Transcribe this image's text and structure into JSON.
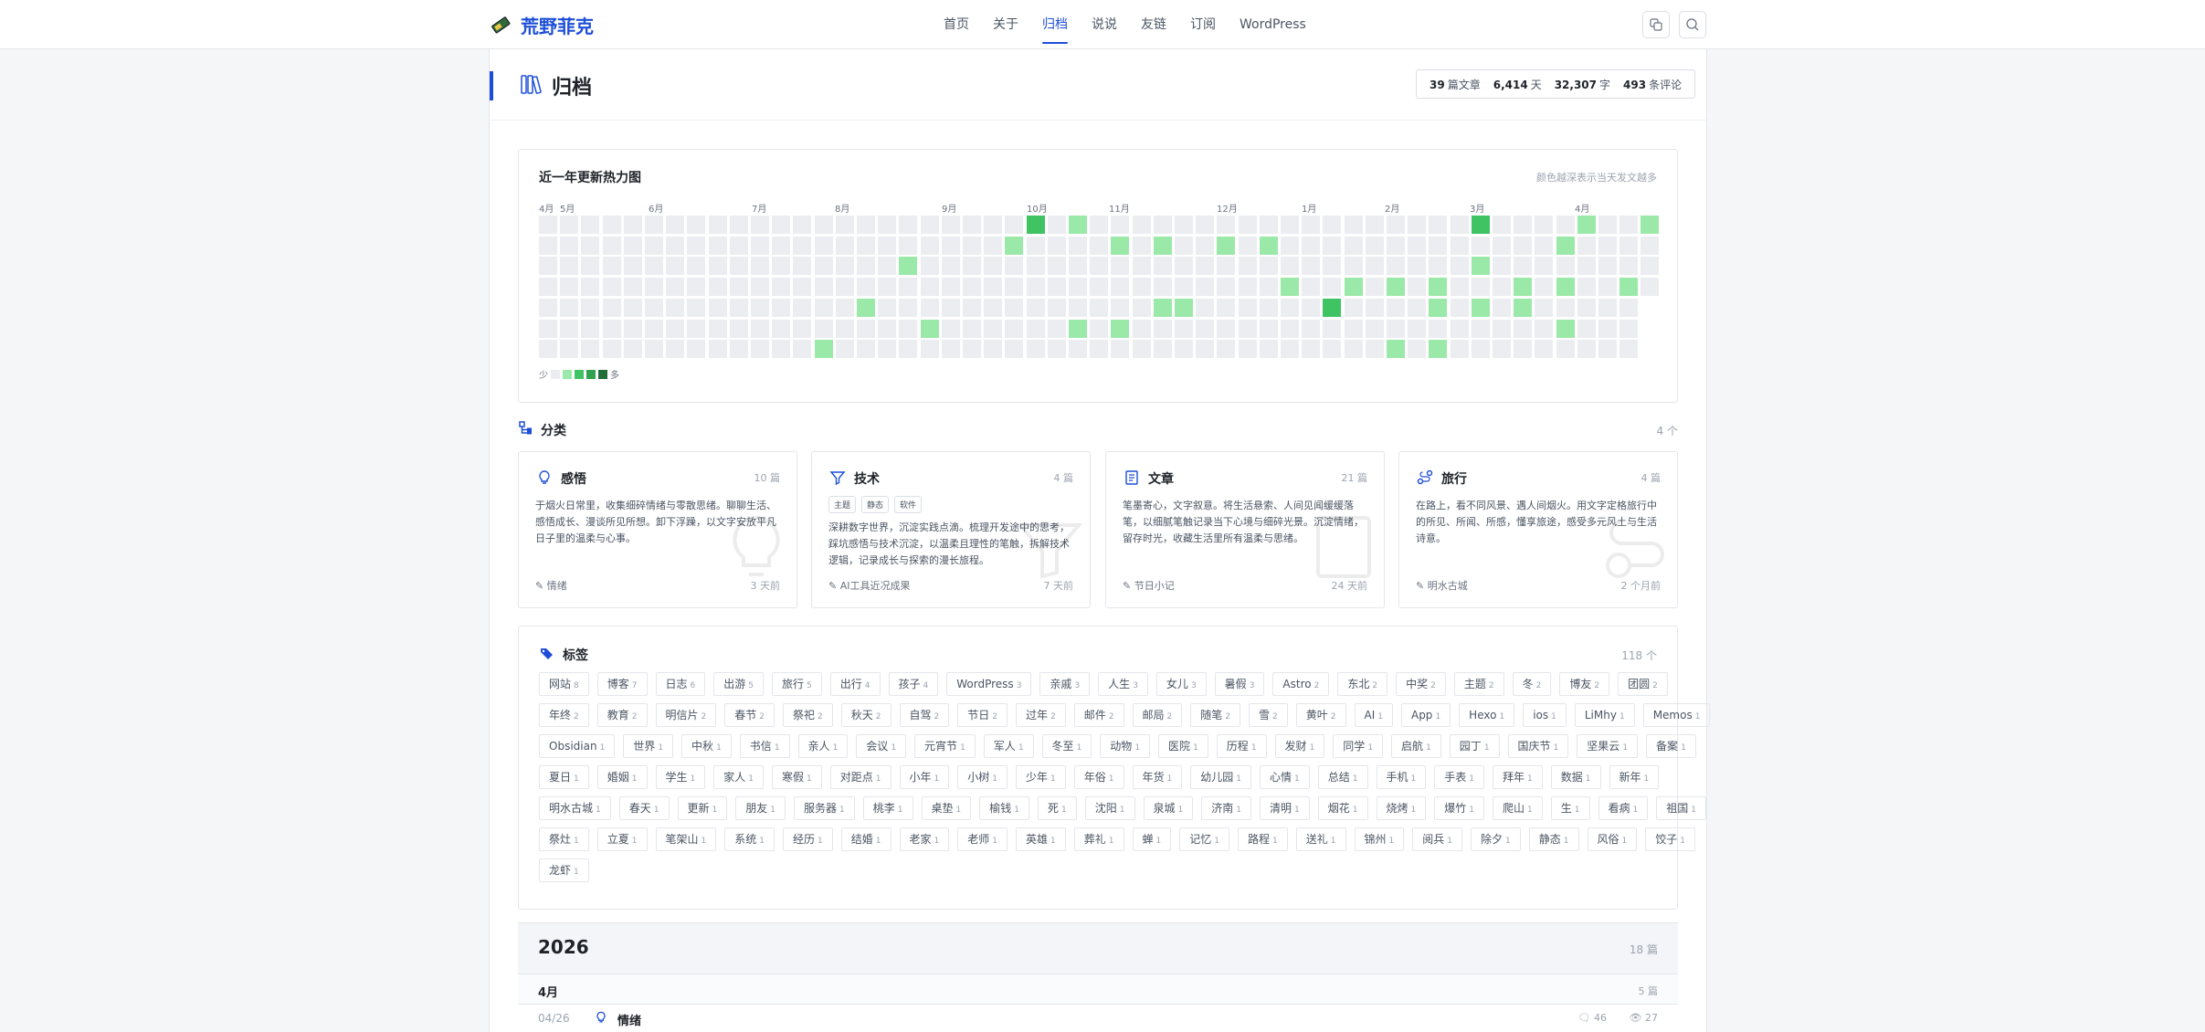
{
  "site": {
    "name": "荒野菲克"
  },
  "nav": [
    {
      "label": "首页",
      "active": false
    },
    {
      "label": "关于",
      "active": false
    },
    {
      "label": "归档",
      "active": true
    },
    {
      "label": "说说",
      "active": false
    },
    {
      "label": "友链",
      "active": false
    },
    {
      "label": "订阅",
      "active": false
    },
    {
      "label": "WordPress",
      "active": false
    }
  ],
  "page": {
    "title": "归档"
  },
  "stats": {
    "posts": "39",
    "posts_unit": "篇文章",
    "days": "6,414",
    "days_unit": "天",
    "words": "32,307",
    "words_unit": "字",
    "comments": "493",
    "comments_unit": "条评论"
  },
  "heatmap": {
    "title": "近一年更新热力图",
    "hint": "颜色越深表示当天发文越多",
    "months": [
      "4月",
      "5月",
      "6月",
      "7月",
      "8月",
      "9月",
      "10月",
      "11月",
      "12月",
      "1月",
      "2月",
      "3月",
      "4月"
    ],
    "legend_less": "少",
    "legend_more": "多",
    "colors": [
      "#ebedf0",
      "#9be9a8",
      "#40c463",
      "#30a14e",
      "#216e39"
    ],
    "active_days": [
      {
        "week": 23,
        "day": 0,
        "level": 2
      },
      {
        "week": 25,
        "day": 0,
        "level": 1
      },
      {
        "week": 44,
        "day": 0,
        "level": 2
      },
      {
        "week": 49,
        "day": 0,
        "level": 1
      },
      {
        "week": 52,
        "day": 0,
        "level": 1
      },
      {
        "week": 22,
        "day": 1,
        "level": 1
      },
      {
        "week": 27,
        "day": 1,
        "level": 1
      },
      {
        "week": 29,
        "day": 1,
        "level": 1
      },
      {
        "week": 32,
        "day": 1,
        "level": 1
      },
      {
        "week": 34,
        "day": 1,
        "level": 1
      },
      {
        "week": 48,
        "day": 1,
        "level": 1
      },
      {
        "week": 17,
        "day": 2,
        "level": 1
      },
      {
        "week": 44,
        "day": 2,
        "level": 1
      },
      {
        "week": 35,
        "day": 3,
        "level": 1
      },
      {
        "week": 38,
        "day": 3,
        "level": 1
      },
      {
        "week": 40,
        "day": 3,
        "level": 1
      },
      {
        "week": 42,
        "day": 3,
        "level": 1
      },
      {
        "week": 46,
        "day": 3,
        "level": 1
      },
      {
        "week": 48,
        "day": 3,
        "level": 1
      },
      {
        "week": 51,
        "day": 3,
        "level": 1
      },
      {
        "week": 15,
        "day": 4,
        "level": 1
      },
      {
        "week": 29,
        "day": 4,
        "level": 1
      },
      {
        "week": 30,
        "day": 4,
        "level": 1
      },
      {
        "week": 37,
        "day": 4,
        "level": 2
      },
      {
        "week": 42,
        "day": 4,
        "level": 1
      },
      {
        "week": 44,
        "day": 4,
        "level": 1
      },
      {
        "week": 46,
        "day": 4,
        "level": 1
      },
      {
        "week": 18,
        "day": 5,
        "level": 1
      },
      {
        "week": 25,
        "day": 5,
        "level": 1
      },
      {
        "week": 27,
        "day": 5,
        "level": 1
      },
      {
        "week": 48,
        "day": 5,
        "level": 1
      },
      {
        "week": 13,
        "day": 6,
        "level": 1
      },
      {
        "week": 40,
        "day": 6,
        "level": 1
      },
      {
        "week": 42,
        "day": 6,
        "level": 1
      }
    ]
  },
  "categories_section": {
    "title": "分类",
    "count": "4 个"
  },
  "categories": [
    {
      "name": "感悟",
      "count": "10 篇",
      "desc": "于烟火日常里，收集细碎情绪与零散思绪。聊聊生活、感悟成长、漫谈所见所想。卸下浮躁，以文字安放平凡日子里的温柔与心事。",
      "chips": [],
      "latest": "情绪",
      "time": "3 天前",
      "icon": "lightbulb-icon"
    },
    {
      "name": "技术",
      "count": "4 篇",
      "desc": "深耕数字世界，沉淀实践点滴。梳理开发途中的思考，踩坑感悟与技术沉淀，以温柔且理性的笔触，拆解技术逻辑，记录成长与探索的漫长旅程。",
      "chips": [
        "主题",
        "静态",
        "软件"
      ],
      "latest": "AI工具近况成果",
      "time": "7 天前",
      "icon": "filter-icon"
    },
    {
      "name": "文章",
      "count": "21 篇",
      "desc": "笔墨寄心，文字叙意。将生活悬索、人间见闻缓缓落笔，以细腻笔触记录当下心境与细碎光景。沉淀情绪，留存时光，收藏生活里所有温柔与思绪。",
      "chips": [],
      "latest": "节日小记",
      "time": "24 天前",
      "icon": "document-icon"
    },
    {
      "name": "旅行",
      "count": "4 篇",
      "desc": "在路上，看不同风景、遇人间烟火。用文字定格旅行中的所见、所闻、所感，懂享旅途，感受多元风土与生活诗意。",
      "chips": [],
      "latest": "明水古城",
      "time": "2 个月前",
      "icon": "route-icon"
    }
  ],
  "tags_section": {
    "title": "标签",
    "count": "118 个"
  },
  "tag_rows": [
    [
      [
        "网站",
        "8"
      ],
      [
        "博客",
        "7"
      ],
      [
        "日志",
        "6"
      ],
      [
        "出游",
        "5"
      ],
      [
        "旅行",
        "5"
      ],
      [
        "出行",
        "4"
      ],
      [
        "孩子",
        "4"
      ],
      [
        "WordPress",
        "3"
      ],
      [
        "亲戚",
        "3"
      ],
      [
        "人生",
        "3"
      ],
      [
        "女儿",
        "3"
      ],
      [
        "暑假",
        "3"
      ],
      [
        "Astro",
        "2"
      ],
      [
        "东北",
        "2"
      ],
      [
        "中奖",
        "2"
      ],
      [
        "主题",
        "2"
      ],
      [
        "冬",
        "2"
      ],
      [
        "博友",
        "2"
      ],
      [
        "团圆",
        "2"
      ]
    ],
    [
      [
        "年终",
        "2"
      ],
      [
        "教育",
        "2"
      ],
      [
        "明信片",
        "2"
      ],
      [
        "春节",
        "2"
      ],
      [
        "祭祀",
        "2"
      ],
      [
        "秋天",
        "2"
      ],
      [
        "自驾",
        "2"
      ],
      [
        "节日",
        "2"
      ],
      [
        "过年",
        "2"
      ],
      [
        "邮件",
        "2"
      ],
      [
        "邮局",
        "2"
      ],
      [
        "随笔",
        "2"
      ],
      [
        "雪",
        "2"
      ],
      [
        "黄叶",
        "2"
      ],
      [
        "AI",
        "1"
      ],
      [
        "App",
        "1"
      ],
      [
        "Hexo",
        "1"
      ],
      [
        "ios",
        "1"
      ],
      [
        "LiMhy",
        "1"
      ],
      [
        "Memos",
        "1"
      ]
    ],
    [
      [
        "Obsidian",
        "1"
      ],
      [
        "世界",
        "1"
      ],
      [
        "中秋",
        "1"
      ],
      [
        "书信",
        "1"
      ],
      [
        "亲人",
        "1"
      ],
      [
        "会议",
        "1"
      ],
      [
        "元宵节",
        "1"
      ],
      [
        "军人",
        "1"
      ],
      [
        "冬至",
        "1"
      ],
      [
        "动物",
        "1"
      ],
      [
        "医院",
        "1"
      ],
      [
        "历程",
        "1"
      ],
      [
        "发财",
        "1"
      ],
      [
        "同学",
        "1"
      ],
      [
        "启航",
        "1"
      ],
      [
        "园丁",
        "1"
      ],
      [
        "国庆节",
        "1"
      ],
      [
        "坚果云",
        "1"
      ],
      [
        "备案",
        "1"
      ]
    ],
    [
      [
        "夏日",
        "1"
      ],
      [
        "婚姻",
        "1"
      ],
      [
        "学生",
        "1"
      ],
      [
        "家人",
        "1"
      ],
      [
        "寒假",
        "1"
      ],
      [
        "对距点",
        "1"
      ],
      [
        "小年",
        "1"
      ],
      [
        "小树",
        "1"
      ],
      [
        "少年",
        "1"
      ],
      [
        "年俗",
        "1"
      ],
      [
        "年货",
        "1"
      ],
      [
        "幼儿园",
        "1"
      ],
      [
        "心情",
        "1"
      ],
      [
        "总结",
        "1"
      ],
      [
        "手机",
        "1"
      ],
      [
        "手表",
        "1"
      ],
      [
        "拜年",
        "1"
      ],
      [
        "数据",
        "1"
      ],
      [
        "新年",
        "1"
      ]
    ],
    [
      [
        "明水古城",
        "1"
      ],
      [
        "春天",
        "1"
      ],
      [
        "更新",
        "1"
      ],
      [
        "朋友",
        "1"
      ],
      [
        "服务器",
        "1"
      ],
      [
        "桃李",
        "1"
      ],
      [
        "桌垫",
        "1"
      ],
      [
        "榆钱",
        "1"
      ],
      [
        "死",
        "1"
      ],
      [
        "沈阳",
        "1"
      ],
      [
        "泉城",
        "1"
      ],
      [
        "济南",
        "1"
      ],
      [
        "清明",
        "1"
      ],
      [
        "烟花",
        "1"
      ],
      [
        "烧烤",
        "1"
      ],
      [
        "爆竹",
        "1"
      ],
      [
        "爬山",
        "1"
      ],
      [
        "生",
        "1"
      ],
      [
        "看病",
        "1"
      ],
      [
        "祖国",
        "1"
      ]
    ],
    [
      [
        "祭灶",
        "1"
      ],
      [
        "立夏",
        "1"
      ],
      [
        "笔架山",
        "1"
      ],
      [
        "系统",
        "1"
      ],
      [
        "经历",
        "1"
      ],
      [
        "结婚",
        "1"
      ],
      [
        "老家",
        "1"
      ],
      [
        "老师",
        "1"
      ],
      [
        "英雄",
        "1"
      ],
      [
        "葬礼",
        "1"
      ],
      [
        "蝉",
        "1"
      ],
      [
        "记忆",
        "1"
      ],
      [
        "路程",
        "1"
      ],
      [
        "送礼",
        "1"
      ],
      [
        "锦州",
        "1"
      ],
      [
        "阅兵",
        "1"
      ],
      [
        "除夕",
        "1"
      ],
      [
        "静态",
        "1"
      ],
      [
        "风俗",
        "1"
      ],
      [
        "饺子",
        "1"
      ]
    ],
    [
      [
        "龙虾",
        "1"
      ]
    ]
  ],
  "archive": {
    "year": "2026",
    "year_count": "18 篇",
    "month": "4月",
    "month_count": "5 篇",
    "first_post": {
      "date": "04/26",
      "title": "情绪",
      "comments": "46",
      "views": "27"
    }
  }
}
